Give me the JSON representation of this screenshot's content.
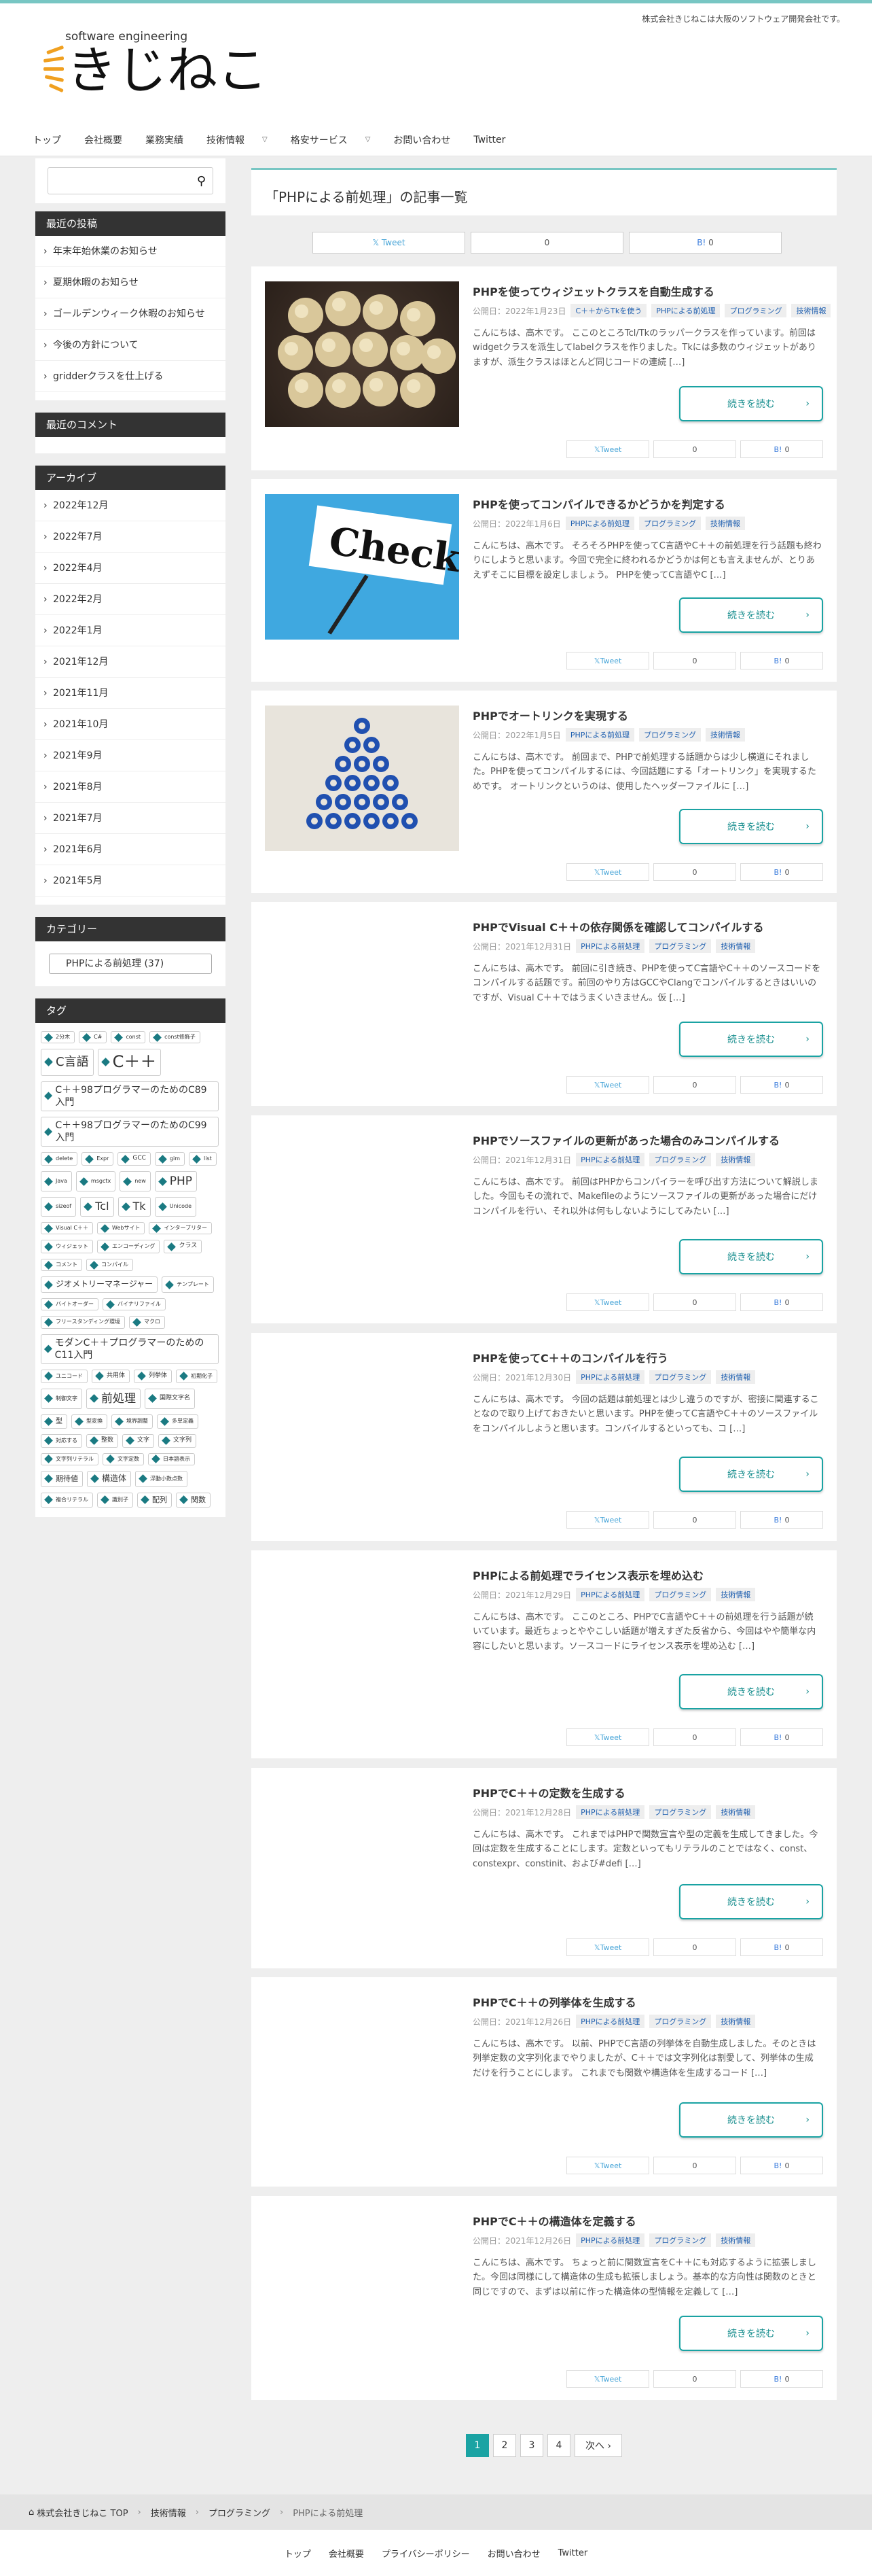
{
  "header": {
    "tagline": "株式会社きじねこは大阪のソフトウェア開発会社です。",
    "logo_top": "software engineering",
    "logo_main": "きじねこ"
  },
  "nav": [
    "トップ",
    "会社概要",
    "業務実績",
    "技術情報",
    "格安サービス",
    "お問い合わせ",
    "Twitter"
  ],
  "sidebar": {
    "recent_title": "最近の投稿",
    "recent": [
      "年末年始休業のお知らせ",
      "夏期休暇のお知らせ",
      "ゴールデンウィーク休暇のお知らせ",
      "今後の方針について",
      "gridderクラスを仕上げる"
    ],
    "comments_title": "最近のコメント",
    "archive_title": "アーカイブ",
    "archives": [
      "2022年12月",
      "2022年7月",
      "2022年4月",
      "2022年2月",
      "2022年1月",
      "2021年12月",
      "2021年11月",
      "2021年10月",
      "2021年9月",
      "2021年8月",
      "2021年7月",
      "2021年6月",
      "2021年5月"
    ],
    "category_title": "カテゴリー",
    "category_selected": "PHPによる前処理  (37)",
    "tags_title": "タグ",
    "tags": [
      {
        "t": "2分木",
        "s": 8
      },
      {
        "t": "C#",
        "s": 8
      },
      {
        "t": "const",
        "s": 8
      },
      {
        "t": "const修飾子",
        "s": 8
      },
      {
        "t": "C言語",
        "s": 18
      },
      {
        "t": "C＋＋",
        "s": 24
      },
      {
        "t": "C＋＋98プログラマーのためのC89入門",
        "s": 14
      },
      {
        "t": "C＋＋98プログラマーのためのC99入門",
        "s": 14
      },
      {
        "t": "delete",
        "s": 8
      },
      {
        "t": "Expr",
        "s": 8
      },
      {
        "t": "GCC",
        "s": 9
      },
      {
        "t": "gim",
        "s": 8
      },
      {
        "t": "list",
        "s": 8
      },
      {
        "t": "Java",
        "s": 8
      },
      {
        "t": "msgctx",
        "s": 8
      },
      {
        "t": "new",
        "s": 8
      },
      {
        "t": "PHP",
        "s": 17
      },
      {
        "t": "sizeof",
        "s": 8
      },
      {
        "t": "Tcl",
        "s": 16
      },
      {
        "t": "Tk",
        "s": 16
      },
      {
        "t": "Unicode",
        "s": 8
      },
      {
        "t": "Visual C＋＋",
        "s": 8
      },
      {
        "t": "Webサイト",
        "s": 8
      },
      {
        "t": "インターブリター",
        "s": 8
      },
      {
        "t": "ウィジェット",
        "s": 8
      },
      {
        "t": "エンコーディング",
        "s": 8
      },
      {
        "t": "クラス",
        "s": 9
      },
      {
        "t": "コメント",
        "s": 8
      },
      {
        "t": "コンパイル",
        "s": 8
      },
      {
        "t": "ジオメトリーマネージャー",
        "s": 12
      },
      {
        "t": "テンプレート",
        "s": 8
      },
      {
        "t": "バイトオーダー",
        "s": 8
      },
      {
        "t": "バイナリファイル",
        "s": 8
      },
      {
        "t": "フリースタンディング環境",
        "s": 8
      },
      {
        "t": "マクロ",
        "s": 8
      },
      {
        "t": "モダンC＋＋プログラマーのためのC11入門",
        "s": 14
      },
      {
        "t": "ユニコード",
        "s": 8
      },
      {
        "t": "共用体",
        "s": 9
      },
      {
        "t": "列挙体",
        "s": 9
      },
      {
        "t": "初期化子",
        "s": 8
      },
      {
        "t": "制御文字",
        "s": 8
      },
      {
        "t": "前処理",
        "s": 17
      },
      {
        "t": "国際文字名",
        "s": 9
      },
      {
        "t": "型",
        "s": 10
      },
      {
        "t": "型変換",
        "s": 8
      },
      {
        "t": "境界調整",
        "s": 8
      },
      {
        "t": "多単定義",
        "s": 8
      },
      {
        "t": "対応する",
        "s": 8
      },
      {
        "t": "整数",
        "s": 9
      },
      {
        "t": "文字",
        "s": 9
      },
      {
        "t": "文字列",
        "s": 9
      },
      {
        "t": "文字列リテラル",
        "s": 8
      },
      {
        "t": "文字定数",
        "s": 8
      },
      {
        "t": "日本語表示",
        "s": 8
      },
      {
        "t": "期待値",
        "s": 11
      },
      {
        "t": "構造体",
        "s": 12
      },
      {
        "t": "浮動小数点数",
        "s": 8
      },
      {
        "t": "複合リテラル",
        "s": 8
      },
      {
        "t": "識別子",
        "s": 8
      },
      {
        "t": "配列",
        "s": 11
      },
      {
        "t": "関数",
        "s": 11
      }
    ]
  },
  "main": {
    "archive_heading": "「PHPによる前処理」の記事一覧",
    "share": {
      "tweet": "Tweet",
      "count": "0",
      "hatena": "B!",
      "hcount": "0"
    },
    "more": "続きを読む",
    "posts": [
      {
        "title": "PHPを使ってウィジェットクラスを自動生成する",
        "date": "公開日：2022年1月23日",
        "cats": [
          "C＋＋からTkを使う",
          "PHPによる前処理",
          "プログラミング",
          "技術情報"
        ],
        "excerpt": "こんにちは、高木です。 ここのところTcl/Tkのラッパークラスを作っています。前回はwidgetクラスを派生してlabelクラスを作りました。Tkには多数のウィジェットがありますが、派生クラスはほとんど同じコードの連続 […]"
      },
      {
        "title": "PHPを使ってコンパイルできるかどうかを判定する",
        "date": "公開日：2022年1月6日",
        "cats": [
          "PHPによる前処理",
          "プログラミング",
          "技術情報"
        ],
        "excerpt": "こんにちは、高木です。 そろそろPHPを使ってC言語やC＋＋の前処理を行う話題も終わりにしようと思います。今回で完全に終われるかどうかは何とも言えませんが、とりあえずそこに目標を設定しましょう。 PHPを使ってC言語やC […]"
      },
      {
        "title": "PHPでオートリンクを実現する",
        "date": "公開日：2022年1月5日",
        "cats": [
          "PHPによる前処理",
          "プログラミング",
          "技術情報"
        ],
        "excerpt": "こんにちは、高木です。 前回まで、PHPで前処理する話題からは少し横道にそれました。PHPを使ってコンパイルするには、今回話題にする「オートリンク」を実現するためです。 オートリンクというのは、使用したヘッダーファイルに […]"
      },
      {
        "title": "PHPでVisual C＋＋の依存関係を確認してコンパイルする",
        "date": "公開日：2021年12月31日",
        "cats": [
          "PHPによる前処理",
          "プログラミング",
          "技術情報"
        ],
        "excerpt": "こんにちは、高木です。 前回に引き続き、PHPを使ってC言語やC＋＋のソースコードをコンパイルする話題です。前回のやり方はGCCやClangでコンパイルするときはいいのですが、Visual C＋＋ではうまくいきません。仮 […]"
      },
      {
        "title": "PHPでソースファイルの更新があった場合のみコンパイルする",
        "date": "公開日：2021年12月31日",
        "cats": [
          "PHPによる前処理",
          "プログラミング",
          "技術情報"
        ],
        "excerpt": "こんにちは、高木です。 前回はPHPからコンパイラーを呼び出す方法について解説しました。今回もその流れで、Makefileのようにソースファイルの更新があった場合にだけコンパイルを行い、それ以外は何もしないようにしてみたい […]"
      },
      {
        "title": "PHPを使ってC＋＋のコンパイルを行う",
        "date": "公開日：2021年12月30日",
        "cats": [
          "PHPによる前処理",
          "プログラミング",
          "技術情報"
        ],
        "excerpt": "こんにちは、高木です。 今回の話題は前処理とは少し違うのですが、密接に関連することなので取り上げておきたいと思います。PHPを使ってC言語やC＋＋のソースファイルをコンパイルしようと思います。コンパイルするといっても、コ […]"
      },
      {
        "title": "PHPによる前処理でライセンス表示を埋め込む",
        "date": "公開日：2021年12月29日",
        "cats": [
          "PHPによる前処理",
          "プログラミング",
          "技術情報"
        ],
        "excerpt": "こんにちは、高木です。 ここのところ、PHPでC言語やC＋＋の前処理を行う話題が続いています。最近ちょっとややこしい話題が増えすぎた反省から、今回はやや簡単な内容にしたいと思います。ソースコードにライセンス表示を埋め込む […]"
      },
      {
        "title": "PHPでC＋＋の定数を生成する",
        "date": "公開日：2021年12月28日",
        "cats": [
          "PHPによる前処理",
          "プログラミング",
          "技術情報"
        ],
        "excerpt": "こんにちは、高木です。 これまではPHPで関数宣言や型の定義を生成してきました。今回は定数を生成することにします。定数といってもリテラルのことではなく、const、constexpr、constinit、および#defi […]"
      },
      {
        "title": "PHPでC＋＋の列挙体を生成する",
        "date": "公開日：2021年12月26日",
        "cats": [
          "PHPによる前処理",
          "プログラミング",
          "技術情報"
        ],
        "excerpt": "こんにちは、高木です。 以前、PHPでC言語の列挙体を自動生成しました。そのときは列挙定数の文字列化までやりましたが、C＋＋では文字列化は割愛して、列挙体の生成だけを行うことにします。 これまでも関数や構造体を生成するコード […]"
      },
      {
        "title": "PHPでC＋＋の構造体を定義する",
        "date": "公開日：2021年12月26日",
        "cats": [
          "PHPによる前処理",
          "プログラミング",
          "技術情報"
        ],
        "excerpt": "こんにちは、高木です。 ちょっと前に関数宣言をC＋＋にも対応するように拡張しました。今回は同様にして構造体の生成も拡張しましょう。基本的な方向性は関数のときと同じですので、まずは以前に作った構造体の型情報を定義して […]"
      }
    ]
  },
  "pager": {
    "pages": [
      "1",
      "2",
      "3",
      "4"
    ],
    "next": "次へ ›"
  },
  "breadcrumb": [
    "株式会社きじねこ TOP",
    "技術情報",
    "プログラミング",
    "PHPによる前処理"
  ],
  "footer": [
    "トップ",
    "会社概要",
    "プライバシーポリシー",
    "お問い合わせ",
    "Twitter"
  ]
}
